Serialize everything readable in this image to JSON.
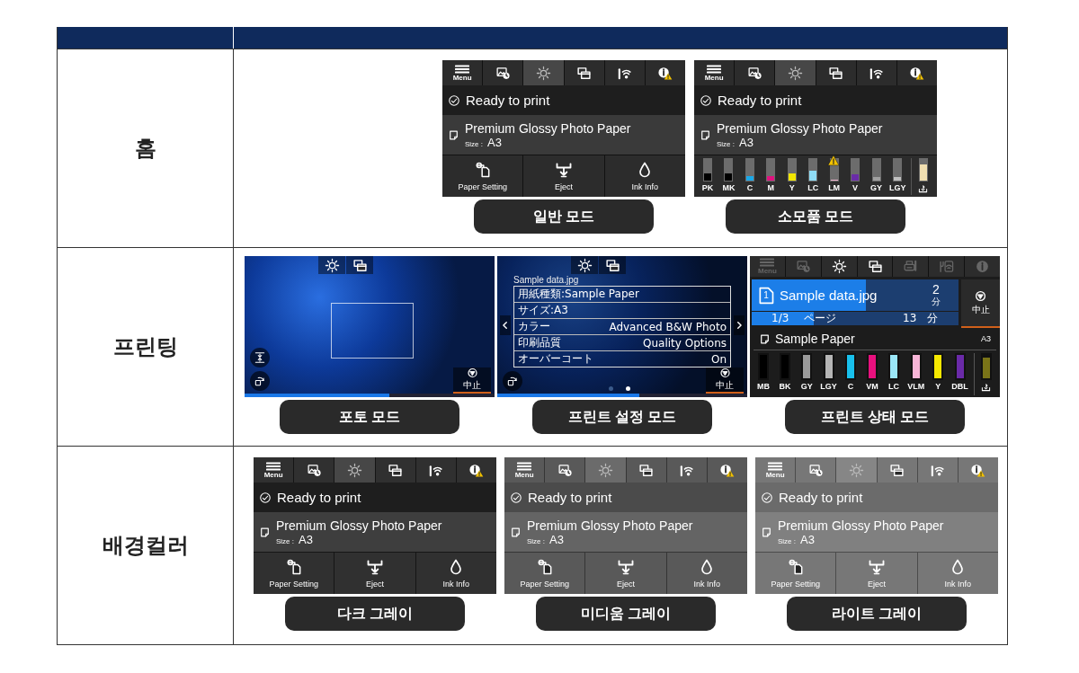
{
  "table": {
    "rows": [
      {
        "label": "홈",
        "panels": [
          {
            "kind": "home",
            "tabs": [
              {
                "kind": "menu",
                "label": "Menu",
                "selected": false,
                "disabled": false
              },
              {
                "kind": "photo",
                "selected": false,
                "disabled": false
              },
              {
                "kind": "sun",
                "selected": true,
                "disabled": false
              },
              {
                "kind": "windows",
                "selected": false,
                "disabled": false
              },
              {
                "kind": "wifi",
                "selected": false,
                "disabled": false
              },
              {
                "kind": "info-warning",
                "selected": false,
                "disabled": false
              }
            ],
            "status": "Ready to print",
            "paper": "Premium Glossy Photo Paper",
            "size_label": "Size :",
            "size": "A3",
            "buttons": [
              {
                "kind": "paper-setting",
                "label": "Paper Setting"
              },
              {
                "kind": "eject",
                "label": "Eject"
              },
              {
                "kind": "ink",
                "label": "Ink Info"
              }
            ],
            "caption": "일반 모드"
          },
          {
            "kind": "ink",
            "tabs": [
              {
                "kind": "menu",
                "label": "Menu",
                "selected": false,
                "disabled": false
              },
              {
                "kind": "photo",
                "selected": false,
                "disabled": false
              },
              {
                "kind": "sun",
                "selected": true,
                "disabled": false
              },
              {
                "kind": "windows",
                "selected": false,
                "disabled": false
              },
              {
                "kind": "wifi",
                "selected": false,
                "disabled": false
              },
              {
                "kind": "info-warning",
                "selected": false,
                "disabled": false
              }
            ],
            "status": "Ready to print",
            "paper": "Premium Glossy Photo Paper",
            "size_label": "Size :",
            "size": "A3",
            "inks": [
              {
                "label": "PK",
                "color": "#000000",
                "level": 0.35,
                "warning": false
              },
              {
                "label": "MK",
                "color": "#000000",
                "level": 0.35,
                "warning": false
              },
              {
                "label": "C",
                "color": "#1aa8e8",
                "level": 0.2,
                "warning": false
              },
              {
                "label": "M",
                "color": "#e0117f",
                "level": 0.2,
                "warning": false
              },
              {
                "label": "Y",
                "color": "#f2e600",
                "level": 0.35,
                "warning": false
              },
              {
                "label": "LC",
                "color": "#8fdcf5",
                "level": 0.45,
                "warning": false
              },
              {
                "label": "LM",
                "color": "#f5b6d2",
                "level": 0.06,
                "warning": true
              },
              {
                "label": "V",
                "color": "#6a2ca8",
                "level": 0.3,
                "warning": false
              },
              {
                "label": "GY",
                "color": "#a0a0a0",
                "level": 0.15,
                "warning": false
              },
              {
                "label": "LGY",
                "color": "#c0c0c0",
                "level": 0.15,
                "warning": false
              }
            ],
            "maintenance": {
              "color": "#f1dfb0",
              "level": 0.75
            },
            "caption": "소모품 모드"
          }
        ]
      },
      {
        "label": "프린팅",
        "panels": [
          {
            "kind": "photo",
            "tabs": [
              {
                "kind": "sun"
              },
              {
                "kind": "windows"
              }
            ],
            "stop": "中止",
            "progress": {
              "level": 0.58
            },
            "caption": "포토 모드"
          },
          {
            "kind": "settings",
            "tabs": [
              {
                "kind": "sun"
              },
              {
                "kind": "windows"
              }
            ],
            "file": "Sample data.jpg",
            "settings": [
              {
                "label": "用紙種類:Sample Paper"
              },
              {
                "label": "サイズ:A3"
              },
              {
                "label": "カラー",
                "value": "Advanced B&W Photo"
              },
              {
                "label": "印刷品質",
                "value": "Quality Options"
              },
              {
                "label": "オーバーコート",
                "value": "On"
              }
            ],
            "pages": [
              {
                "selected": false
              },
              {
                "selected": true
              }
            ],
            "stop": "中止",
            "progress": {
              "level": 0.57
            },
            "caption": "프린트 설정 모드"
          },
          {
            "kind": "status",
            "tabs": [
              {
                "kind": "menu",
                "label": "Menu",
                "selected": false,
                "disabled": true
              },
              {
                "kind": "photo",
                "selected": false,
                "disabled": true
              },
              {
                "kind": "sun",
                "selected": false,
                "disabled": false
              },
              {
                "kind": "windows",
                "selected": false,
                "disabled": false
              },
              {
                "kind": "printer",
                "selected": false,
                "disabled": true
              },
              {
                "kind": "tools-wifi",
                "selected": false,
                "disabled": true
              },
              {
                "kind": "info",
                "selected": false,
                "disabled": true
              }
            ],
            "job": {
              "number": "1",
              "file": "Sample data.jpg",
              "level": 0.55,
              "time": "2",
              "time_unit": "分",
              "pages": "1/3",
              "pages_unit": "ページ",
              "page_progress": {
                "level": 0.3
              },
              "total_time": "13",
              "total_unit": "分"
            },
            "stop": "中止",
            "paper": "Sample Paper",
            "size": "A3",
            "inks": [
              {
                "label": "MB",
                "color": "#000000",
                "level": 1,
                "warning": false
              },
              {
                "label": "BK",
                "color": "#000000",
                "level": 1,
                "warning": false
              },
              {
                "label": "GY",
                "color": "#9a9a9a",
                "level": 1,
                "warning": false
              },
              {
                "label": "LGY",
                "color": "#b5b5b5",
                "level": 1,
                "warning": false
              },
              {
                "label": "C",
                "color": "#18c0ec",
                "level": 1,
                "warning": false
              },
              {
                "label": "VM",
                "color": "#e8107e",
                "level": 1,
                "warning": false
              },
              {
                "label": "LC",
                "color": "#9ae6f7",
                "level": 1,
                "warning": false
              },
              {
                "label": "VLM",
                "color": "#f7b4d6",
                "level": 1,
                "warning": false
              },
              {
                "label": "Y",
                "color": "#f5e800",
                "level": 1,
                "warning": false
              },
              {
                "label": "DBL",
                "color": "#6a2aa8",
                "level": 1,
                "warning": false
              }
            ],
            "maintenance": {
              "color": "#7a7418",
              "level": 0.9
            },
            "caption": "프린트 상태 모드"
          }
        ]
      },
      {
        "label": "배경컬러",
        "panels": [
          {
            "kind": "home",
            "color": "#1e1e1e",
            "tabs": [
              {
                "kind": "menu",
                "label": "Menu",
                "selected": false,
                "disabled": false
              },
              {
                "kind": "photo",
                "selected": false,
                "disabled": false
              },
              {
                "kind": "sun",
                "selected": true,
                "disabled": false
              },
              {
                "kind": "windows",
                "selected": false,
                "disabled": false
              },
              {
                "kind": "wifi",
                "selected": false,
                "disabled": false
              },
              {
                "kind": "info-warning",
                "selected": false,
                "disabled": false
              }
            ],
            "status": "Ready to print",
            "paper": "Premium Glossy Photo Paper",
            "size_label": "Size :",
            "size": "A3",
            "buttons": [
              {
                "kind": "paper-setting",
                "label": "Paper Setting"
              },
              {
                "kind": "eject",
                "label": "Eject"
              },
              {
                "kind": "ink",
                "label": "Ink Info"
              }
            ],
            "caption": "다크 그레이"
          },
          {
            "kind": "home",
            "color": "#4b4b4b",
            "tabs": [
              {
                "kind": "menu",
                "label": "Menu",
                "selected": false,
                "disabled": false
              },
              {
                "kind": "photo",
                "selected": false,
                "disabled": false
              },
              {
                "kind": "sun",
                "selected": true,
                "disabled": false
              },
              {
                "kind": "windows",
                "selected": false,
                "disabled": false
              },
              {
                "kind": "wifi",
                "selected": false,
                "disabled": false
              },
              {
                "kind": "info-warning",
                "selected": false,
                "disabled": false
              }
            ],
            "status": "Ready to print",
            "paper": "Premium Glossy Photo Paper",
            "size_label": "Size :",
            "size": "A3",
            "buttons": [
              {
                "kind": "paper-setting",
                "label": "Paper Setting"
              },
              {
                "kind": "eject",
                "label": "Eject"
              },
              {
                "kind": "ink",
                "label": "Ink Info"
              }
            ],
            "caption": "미디움 그레이"
          },
          {
            "kind": "home",
            "color": "#6b6b6b",
            "tabs": [
              {
                "kind": "menu",
                "label": "Menu",
                "selected": false,
                "disabled": false
              },
              {
                "kind": "photo",
                "selected": false,
                "disabled": false
              },
              {
                "kind": "sun",
                "selected": true,
                "disabled": false
              },
              {
                "kind": "windows",
                "selected": false,
                "disabled": false
              },
              {
                "kind": "wifi",
                "selected": false,
                "disabled": false
              },
              {
                "kind": "info-warning",
                "selected": false,
                "disabled": false
              }
            ],
            "status": "Ready to print",
            "paper": "Premium Glossy Photo Paper",
            "size_label": "Size :",
            "size": "A3",
            "buttons": [
              {
                "kind": "paper-setting",
                "label": "Paper Setting"
              },
              {
                "kind": "eject",
                "label": "Eject"
              },
              {
                "kind": "ink",
                "label": "Ink Info"
              }
            ],
            "caption": "라이트 그레이"
          }
        ]
      }
    ]
  }
}
